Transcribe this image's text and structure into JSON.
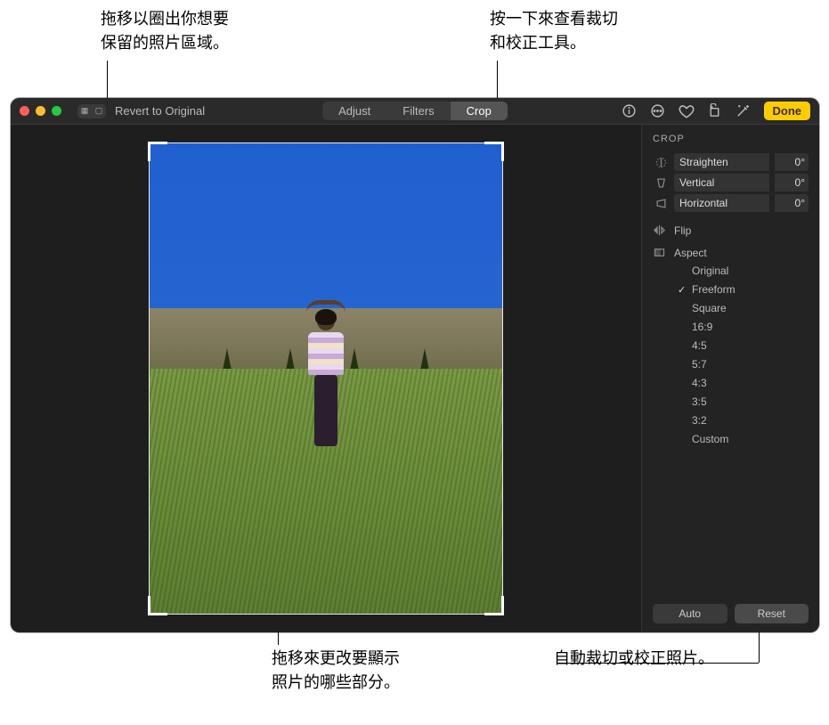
{
  "callouts": {
    "drag_select": "拖移以圈出你想要\n保留的照片區域。",
    "click_crop_tools": "按一下來查看裁切\n和校正工具。",
    "drag_change": "拖移來更改要顯示\n照片的哪些部分。",
    "auto_crop": "自動裁切或校正照片。"
  },
  "toolbar": {
    "revert": "Revert to Original",
    "tabs": {
      "adjust": "Adjust",
      "filters": "Filters",
      "crop": "Crop"
    },
    "done": "Done"
  },
  "sidebar": {
    "title": "CROP",
    "sliders": {
      "straighten": {
        "label": "Straighten",
        "value": "0°"
      },
      "vertical": {
        "label": "Vertical",
        "value": "0°"
      },
      "horizontal": {
        "label": "Horizontal",
        "value": "0°"
      }
    },
    "flip_label": "Flip",
    "aspect_label": "Aspect",
    "aspect_options": [
      "Original",
      "Freeform",
      "Square",
      "16:9",
      "4:5",
      "5:7",
      "4:3",
      "3:5",
      "3:2",
      "Custom"
    ],
    "aspect_selected": "Freeform",
    "footer": {
      "auto": "Auto",
      "reset": "Reset"
    }
  }
}
